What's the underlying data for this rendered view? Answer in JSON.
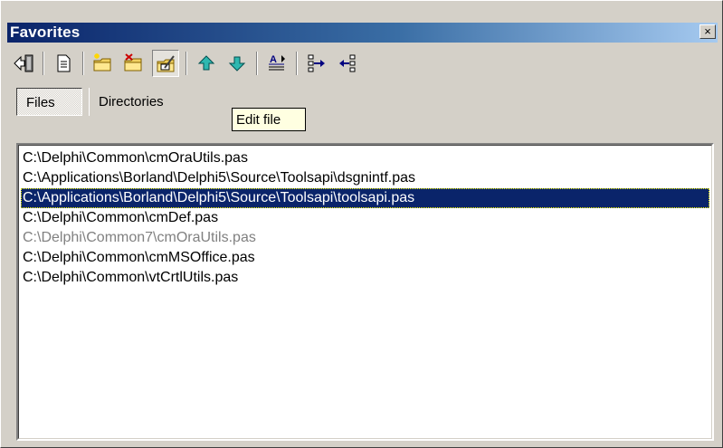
{
  "window": {
    "title": "Favorites",
    "close_symbol": "×"
  },
  "toolbar": {
    "buttons": [
      {
        "name": "exit-icon",
        "tooltip": ""
      },
      {
        "name": "document-icon",
        "tooltip": ""
      },
      {
        "name": "add-folder-icon",
        "tooltip": ""
      },
      {
        "name": "remove-folder-icon",
        "tooltip": ""
      },
      {
        "name": "edit-file-icon",
        "tooltip": "Edit file",
        "pressed": true
      },
      {
        "name": "move-up-icon",
        "tooltip": ""
      },
      {
        "name": "move-down-icon",
        "tooltip": ""
      },
      {
        "name": "sort-icon",
        "tooltip": ""
      },
      {
        "name": "expand-icon",
        "tooltip": ""
      },
      {
        "name": "collapse-icon",
        "tooltip": ""
      }
    ]
  },
  "tabs": {
    "files": "Files",
    "directories": "Directories"
  },
  "tooltip": "Edit file",
  "list": {
    "items": [
      {
        "path": "C:\\Delphi\\Common\\cmOraUtils.pas",
        "state": "normal"
      },
      {
        "path": "C:\\Applications\\Borland\\Delphi5\\Source\\Toolsapi\\dsgnintf.pas",
        "state": "normal"
      },
      {
        "path": "C:\\Applications\\Borland\\Delphi5\\Source\\Toolsapi\\toolsapi.pas",
        "state": "selected"
      },
      {
        "path": "C:\\Delphi\\Common\\cmDef.pas",
        "state": "normal"
      },
      {
        "path": "C:\\Delphi\\Common7\\cmOraUtils.pas",
        "state": "disabled"
      },
      {
        "path": "C:\\Delphi\\Common\\cmMSOffice.pas",
        "state": "normal"
      },
      {
        "path": "C:\\Delphi\\Common\\vtCrtlUtils.pas",
        "state": "normal"
      }
    ]
  },
  "colors": {
    "selection": "#0a246a",
    "title_gradient_start": "#0a246a",
    "title_gradient_end": "#a6caf0",
    "disabled_text": "#808080"
  }
}
